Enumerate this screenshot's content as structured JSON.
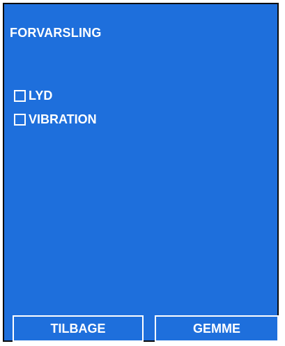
{
  "screen": {
    "title": "FORVARSLING",
    "background_color": "#1e6fdc",
    "options": [
      {
        "label": "LYD",
        "checked": false
      },
      {
        "label": "VIBRATION",
        "checked": false
      }
    ],
    "buttons": {
      "back_label": "TILBAGE",
      "save_label": "GEMME"
    }
  }
}
